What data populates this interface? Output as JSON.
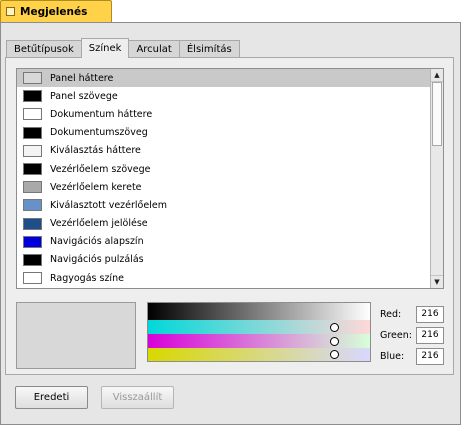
{
  "window": {
    "title": "Megjelenés"
  },
  "tabs": [
    {
      "label": "Betűtípusok",
      "active": false
    },
    {
      "label": "Színek",
      "active": true
    },
    {
      "label": "Arculat",
      "active": false
    },
    {
      "label": "Élsimítás",
      "active": false
    }
  ],
  "color_list": [
    {
      "label": "Panel háttere",
      "color": "#d8d8d8",
      "selected": true
    },
    {
      "label": "Panel szövege",
      "color": "#000000"
    },
    {
      "label": "Dokumentum háttere",
      "color": "#ffffff"
    },
    {
      "label": "Dokumentumszöveg",
      "color": "#000000"
    },
    {
      "label": "Kiválasztás háttere",
      "color": "#f4f4f4"
    },
    {
      "label": "Vezérlőelem szövege",
      "color": "#000000"
    },
    {
      "label": "Vezérlőelem kerete",
      "color": "#a9a9a9"
    },
    {
      "label": "Kiválasztott vezérlőelem",
      "color": "#6792c9"
    },
    {
      "label": "Vezérlőelem jelölése",
      "color": "#1f4f8a"
    },
    {
      "label": "Navigációs alapszín",
      "color": "#0000dd"
    },
    {
      "label": "Navigációs pulzálás",
      "color": "#000000"
    },
    {
      "label": "Ragyogás színe",
      "color": "#ffffff"
    }
  ],
  "preview_color": "#d8d8d8",
  "rgb": {
    "red_label": "Red:",
    "red_value": "216",
    "green_label": "Green:",
    "green_value": "216",
    "blue_label": "Blue:",
    "blue_value": "216"
  },
  "buttons": {
    "defaults": "Eredeti",
    "revert": "Visszaállít"
  },
  "icons": {
    "scroll_up": "▲",
    "scroll_down": "▼"
  }
}
